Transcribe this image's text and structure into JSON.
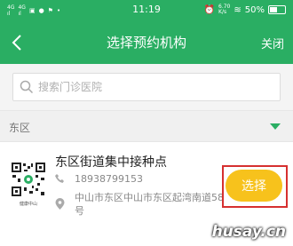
{
  "status_bar": {
    "signal_left": "4G⁺ᵉᵈ",
    "time": "11:19",
    "speed": "6.70\nK/s",
    "battery": "50%"
  },
  "nav": {
    "title": "选择预约机构",
    "close_label": "关闭"
  },
  "search": {
    "placeholder": "搜索门诊医院",
    "value": ""
  },
  "region": {
    "label": "东区"
  },
  "clinic": {
    "name": "东区街道集中接种点",
    "phone": "18938799153",
    "address": "中山市东区中山市东区起湾南道58号",
    "qr_caption": "健康中山",
    "select_label": "选择"
  },
  "watermark": "husay.cn",
  "colors": {
    "primary": "#2aae63",
    "select_button": "#f7c21c",
    "highlight": "#d63030"
  }
}
